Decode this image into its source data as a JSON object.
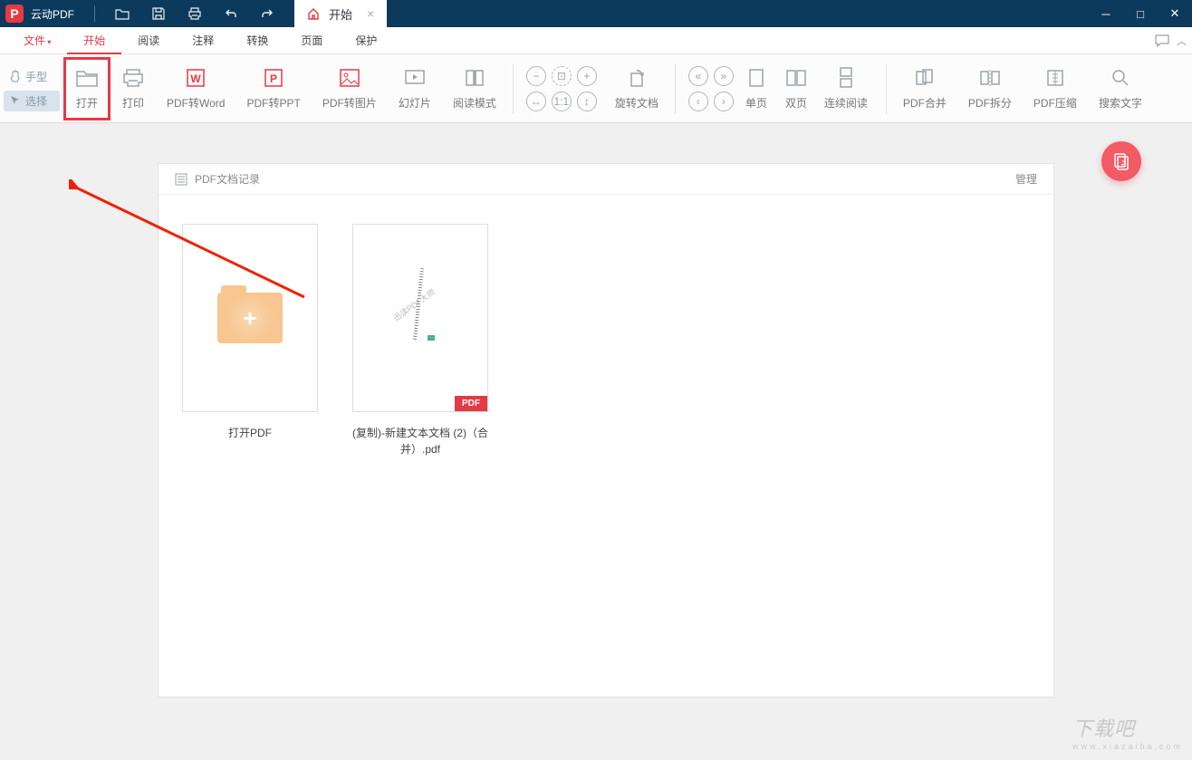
{
  "colors": {
    "accent": "#e63946",
    "header": "#0c3a5c"
  },
  "titlebar": {
    "app_name": "云动PDF"
  },
  "tab": {
    "label": "开始"
  },
  "menu": {
    "file": "文件",
    "items": [
      "开始",
      "阅读",
      "注释",
      "转换",
      "页面",
      "保护"
    ]
  },
  "side_tools": {
    "hand": "手型",
    "select": "选择"
  },
  "toolbar": {
    "open": "打开",
    "print": "打印",
    "to_word": "PDF转Word",
    "to_ppt": "PDF转PPT",
    "to_img": "PDF转图片",
    "slide": "幻灯片",
    "read_mode": "阅读模式",
    "rotate": "旋转文档",
    "single": "单页",
    "double": "双页",
    "continuous": "连续阅读",
    "merge": "PDF合并",
    "split": "PDF拆分",
    "compress": "PDF压缩",
    "search": "搜索文字"
  },
  "panel": {
    "title": "PDF文档记录",
    "manage": "管理",
    "open_card": "打开PDF",
    "recent_doc": "(复制)-新建文本文档 (2)（合并）.pdf",
    "doc_watermark": "迅读PDF大师",
    "badge": "PDF"
  },
  "watermark": {
    "text": "下载吧",
    "url": "www.xiazaiba.com"
  }
}
